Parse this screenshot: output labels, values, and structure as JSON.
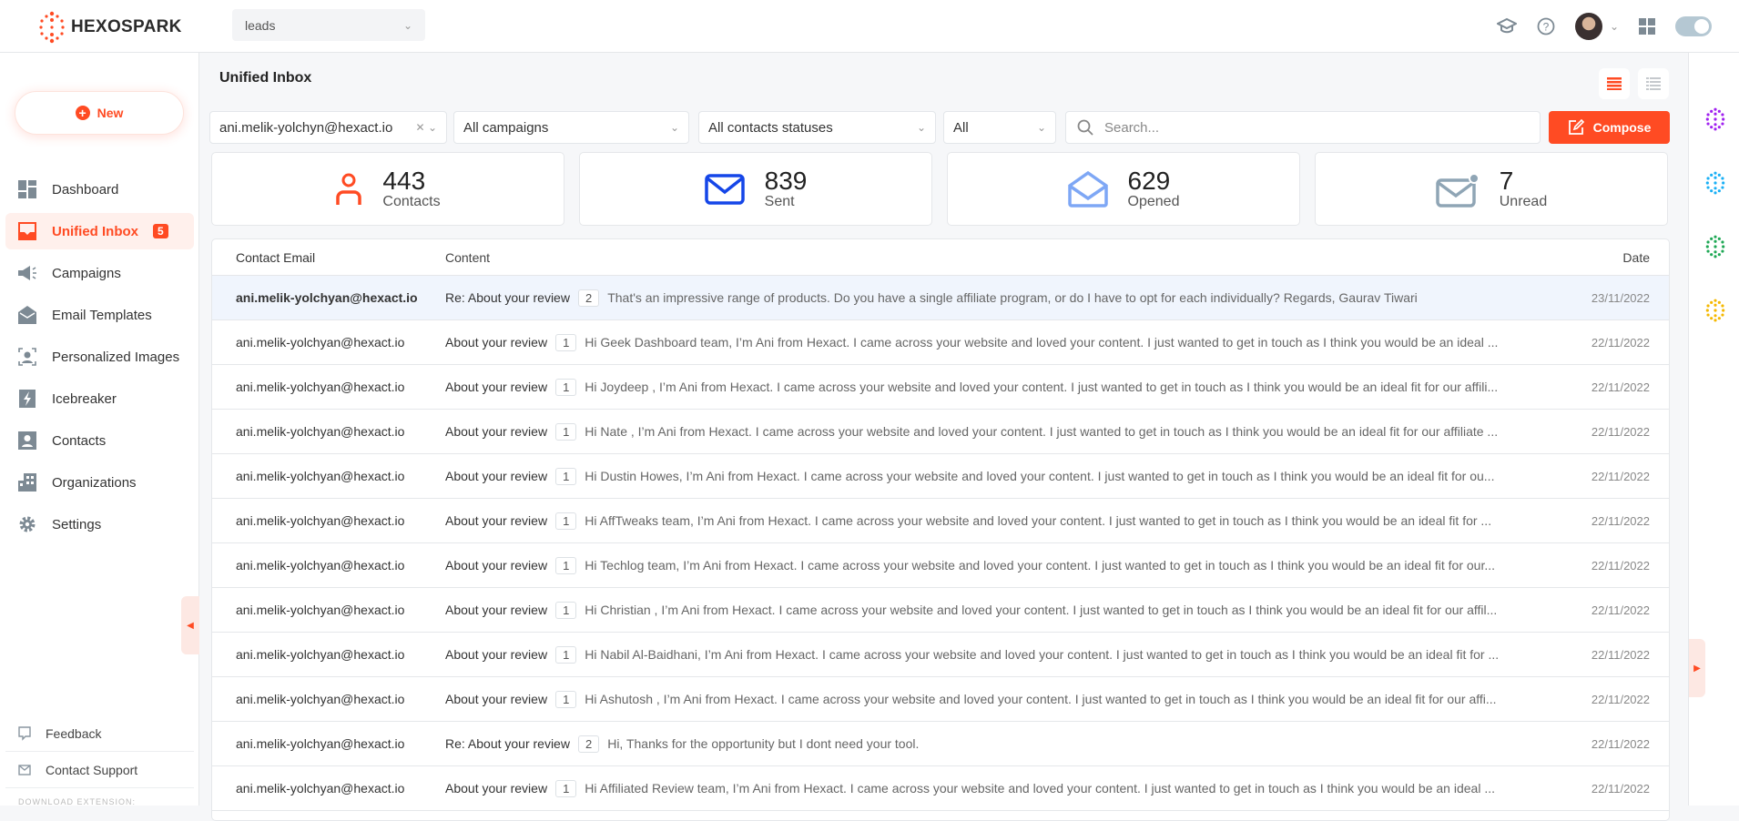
{
  "header": {
    "brand": "HEXOSPARK",
    "workspace": "leads"
  },
  "sidebar": {
    "new_label": "New",
    "items": [
      {
        "label": "Dashboard",
        "icon": "dashboard-icon"
      },
      {
        "label": "Unified Inbox",
        "icon": "inbox-icon",
        "badge": "5",
        "active": true
      },
      {
        "label": "Campaigns",
        "icon": "megaphone-icon"
      },
      {
        "label": "Email Templates",
        "icon": "email-template-icon"
      },
      {
        "label": "Personalized Images",
        "icon": "personalized-image-icon"
      },
      {
        "label": "Icebreaker",
        "icon": "icebreaker-icon"
      },
      {
        "label": "Contacts",
        "icon": "contacts-icon"
      },
      {
        "label": "Organizations",
        "icon": "organizations-icon"
      },
      {
        "label": "Settings",
        "icon": "gear-icon"
      }
    ],
    "feedback": "Feedback",
    "support": "Contact Support",
    "download_extension": "DOWNLOAD EXTENSION:"
  },
  "main": {
    "title": "Unified Inbox",
    "filters": {
      "account": "ani.melik-yolchyn@hexact.io",
      "campaigns": "All campaigns",
      "statuses": "All contacts statuses",
      "type": "All",
      "search_placeholder": "Search..."
    },
    "compose_label": "Compose",
    "stats": [
      {
        "value": "443",
        "label": "Contacts"
      },
      {
        "value": "839",
        "label": "Sent"
      },
      {
        "value": "629",
        "label": "Opened"
      },
      {
        "value": "7",
        "label": "Unread"
      }
    ],
    "columns": {
      "email": "Contact Email",
      "content": "Content",
      "date": "Date"
    },
    "rows": [
      {
        "email": "ani.melik-yolchyan@hexact.io",
        "subject": "Re: About your review",
        "count": "2",
        "body": "That's an impressive range of products. Do you have a single affiliate program, or do I have to opt for each individually? Regards, Gaurav Tiwari",
        "date": "23/11/2022"
      },
      {
        "email": "ani.melik-yolchyan@hexact.io",
        "subject": "About your review",
        "count": "1",
        "body": "Hi Geek Dashboard team, I’m Ani from Hexact. I came across your website and loved your content. I just wanted to get in touch as I think you would be an ideal ...",
        "date": "22/11/2022"
      },
      {
        "email": "ani.melik-yolchyan@hexact.io",
        "subject": "About your review",
        "count": "1",
        "body": "Hi Joydeep , I’m Ani from Hexact. I came across your website and loved your content. I just wanted to get in touch as I think you would be an ideal fit for our affili...",
        "date": "22/11/2022"
      },
      {
        "email": "ani.melik-yolchyan@hexact.io",
        "subject": "About your review",
        "count": "1",
        "body": "Hi Nate , I’m Ani from Hexact. I came across your website and loved your content. I just wanted to get in touch as I think you would be an ideal fit for our affiliate ...",
        "date": "22/11/2022"
      },
      {
        "email": "ani.melik-yolchyan@hexact.io",
        "subject": "About your review",
        "count": "1",
        "body": "Hi Dustin Howes, I’m Ani from Hexact. I came across your website and loved your content. I just wanted to get in touch as I think you would be an ideal fit for ou...",
        "date": "22/11/2022"
      },
      {
        "email": "ani.melik-yolchyan@hexact.io",
        "subject": "About your review",
        "count": "1",
        "body": "Hi AffTweaks team, I’m Ani from Hexact. I came across your website and loved your content. I just wanted to get in touch as I think you would be an ideal fit for ...",
        "date": "22/11/2022"
      },
      {
        "email": "ani.melik-yolchyan@hexact.io",
        "subject": "About your review",
        "count": "1",
        "body": "Hi Techlog team, I’m Ani from Hexact. I came across your website and loved your content. I just wanted to get in touch as I think you would be an ideal fit for our...",
        "date": "22/11/2022"
      },
      {
        "email": "ani.melik-yolchyan@hexact.io",
        "subject": "About your review",
        "count": "1",
        "body": "Hi Christian , I’m Ani from Hexact. I came across your website and loved your content. I just wanted to get in touch as I think you would be an ideal fit for our affil...",
        "date": "22/11/2022"
      },
      {
        "email": "ani.melik-yolchyan@hexact.io",
        "subject": "About your review",
        "count": "1",
        "body": "Hi Nabil Al-Baidhani, I’m Ani from Hexact. I came across your website and loved your content. I just wanted to get in touch as I think you would be an ideal fit for ...",
        "date": "22/11/2022"
      },
      {
        "email": "ani.melik-yolchyan@hexact.io",
        "subject": "About your review",
        "count": "1",
        "body": "Hi Ashutosh , I’m Ani from Hexact. I came across your website and loved your content. I just wanted to get in touch as I think you would be an ideal fit for our affi...",
        "date": "22/11/2022"
      },
      {
        "email": "ani.melik-yolchyan@hexact.io",
        "subject": "Re: About your review",
        "count": "2",
        "body": "Hi, Thanks for the opportunity but I dont need your tool.",
        "date": "22/11/2022"
      },
      {
        "email": "ani.melik-yolchyan@hexact.io",
        "subject": "About your review",
        "count": "1",
        "body": "Hi Affiliated Review team, I’m Ani from Hexact. I came across your website and loved your content. I just wanted to get in touch as I think you would be an ideal ...",
        "date": "22/11/2022"
      }
    ]
  },
  "colors": {
    "accent": "#ff4b23",
    "apps": [
      "#a020f0",
      "#1ab0f5",
      "#1fa855",
      "#f5b800"
    ]
  }
}
